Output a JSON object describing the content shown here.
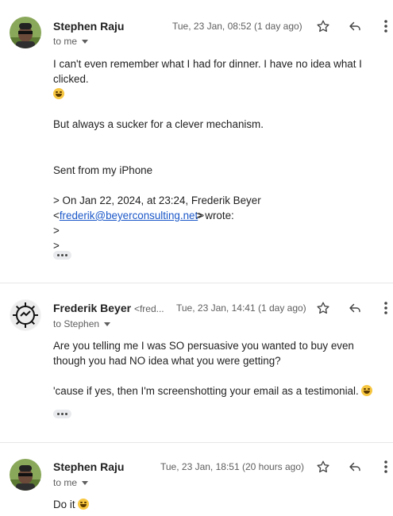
{
  "messages": [
    {
      "sender": "Stephen Raju",
      "date": "Tue, 23 Jan, 08:52 (1 day ago)",
      "recipient": "to me",
      "body": [
        "I can't even remember what I had for dinner. I have no idea what I clicked.",
        " But always a sucker for a clever mechanism.",
        "Sent from my iPhone",
        "> On Jan 22, 2024, at 23:24, Frederik Beyer",
        "frederik@beyerconsulting.net",
        "> wrote:",
        ">",
        ">"
      ],
      "quote_open": "<",
      "avatar": "user-photo"
    },
    {
      "sender": "Frederik Beyer",
      "sender_email": "<fred...",
      "date": "Tue, 23 Jan, 14:41 (1 day ago)",
      "recipient": "to Stephen",
      "body": [
        "Are you telling me I was SO persuasive you wanted to buy even though you had NO idea what you were getting?",
        "'cause if yes, then I'm screenshotting your email as a testimonial."
      ],
      "avatar": "gear-logo"
    },
    {
      "sender": "Stephen Raju",
      "date": "Tue, 23 Jan, 18:51 (20 hours ago)",
      "recipient": "to me",
      "body": [
        "Do it"
      ],
      "avatar": "user-photo"
    }
  ],
  "icons": {
    "star": "star-icon",
    "reply": "reply-icon",
    "more": "more-vert-icon",
    "caret": "chevron-down-icon",
    "trimmed": "show-trimmed-content-icon"
  }
}
